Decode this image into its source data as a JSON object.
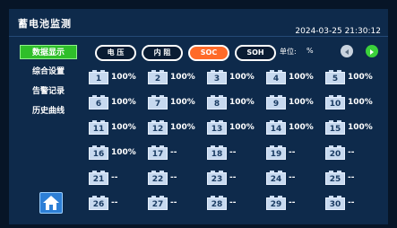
{
  "app_title": "蓄电池监测",
  "datetime": "2024-03-25 21:30:12",
  "nav": [
    {
      "label": "数据显示",
      "active": true
    },
    {
      "label": "综合设置",
      "active": false
    },
    {
      "label": "告警记录",
      "active": false
    },
    {
      "label": "历史曲线",
      "active": false
    }
  ],
  "tabs": [
    {
      "label": "电 压",
      "active": false
    },
    {
      "label": "内 阻",
      "active": false
    },
    {
      "label": "SOC",
      "active": true
    },
    {
      "label": "SOH",
      "active": false
    }
  ],
  "unit_label": "单位:",
  "unit_value": "%",
  "batteries": [
    {
      "id": "1",
      "value": "100%"
    },
    {
      "id": "2",
      "value": "100%"
    },
    {
      "id": "3",
      "value": "100%"
    },
    {
      "id": "4",
      "value": "100%"
    },
    {
      "id": "5",
      "value": "100%"
    },
    {
      "id": "6",
      "value": "100%"
    },
    {
      "id": "7",
      "value": "100%"
    },
    {
      "id": "8",
      "value": "100%"
    },
    {
      "id": "9",
      "value": "100%"
    },
    {
      "id": "10",
      "value": "100%"
    },
    {
      "id": "11",
      "value": "100%"
    },
    {
      "id": "12",
      "value": "100%"
    },
    {
      "id": "13",
      "value": "100%"
    },
    {
      "id": "14",
      "value": "100%"
    },
    {
      "id": "15",
      "value": "100%"
    },
    {
      "id": "16",
      "value": "100%"
    },
    {
      "id": "17",
      "value": "--"
    },
    {
      "id": "18",
      "value": "--"
    },
    {
      "id": "19",
      "value": "--"
    },
    {
      "id": "20",
      "value": "--"
    },
    {
      "id": "21",
      "value": "--"
    },
    {
      "id": "22",
      "value": "--"
    },
    {
      "id": "23",
      "value": "--"
    },
    {
      "id": "24",
      "value": "--"
    },
    {
      "id": "25",
      "value": "--"
    },
    {
      "id": "26",
      "value": "--"
    },
    {
      "id": "27",
      "value": "--"
    },
    {
      "id": "28",
      "value": "--"
    },
    {
      "id": "29",
      "value": "--"
    },
    {
      "id": "30",
      "value": "--"
    }
  ],
  "colors": {
    "background": "#0e2a4b",
    "active_nav": "#2fbf2a",
    "active_tab": "#ff6a28",
    "battery": "#c7d9ef",
    "next_button": "#3bd13b",
    "prev_button": "#c9d3df",
    "home_button": "#2d7fd6"
  },
  "icons": {
    "prev": "arrow-left-icon",
    "next": "arrow-right-icon",
    "home": "home-icon"
  }
}
